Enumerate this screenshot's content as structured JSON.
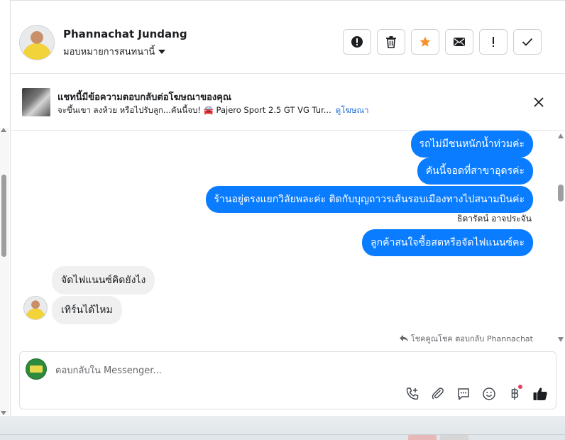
{
  "header": {
    "contact_name": "Phannachat Jundang",
    "assign_label": "มอบหมายการสนทนานี้",
    "actions": [
      {
        "name": "mark-spam-button",
        "icon": "exclamation-circle-icon",
        "glyph": "❗"
      },
      {
        "name": "delete-button",
        "icon": "trash-icon",
        "glyph": "🗑"
      },
      {
        "name": "star-button",
        "icon": "star-icon",
        "glyph": "★"
      },
      {
        "name": "mark-unread-button",
        "icon": "envelope-icon",
        "glyph": "✉"
      },
      {
        "name": "follow-up-button",
        "icon": "exclamation-icon",
        "glyph": "!"
      },
      {
        "name": "mark-done-button",
        "icon": "check-icon",
        "glyph": "✓"
      }
    ]
  },
  "ad": {
    "title": "แชทนี้มีข้อความตอบกลับต่อโฆษณาของคุณ",
    "description": "จะขึ้นเขา ลงห้วย หรือไปรับลูก...คันนี้จบ! 🚘 Pajero Sport 2.5 GT VG Tur...",
    "link_label": "ดูโฆษณา"
  },
  "messages": {
    "outgoing_1": "รถไม่มีชนหนักน้ำท่วมค่ะ",
    "outgoing_2": "คันนี้จอดที่สาขาอุดรค่ะ",
    "outgoing_3": "ร้านอยู่ตรงแยกวิลัยพละค่ะ ติดกับบุญถาวรเส้นรอบเมืองทางไปสนามบินค่ะ",
    "sender_name": "ธิดารัตน์ อาจประจัน",
    "outgoing_4": "ลูกค้าสนใจซื้อสดหรือจัดไฟแนนซ์คะ",
    "incoming_1": "จัดไฟแนนซ์คิดยังไง",
    "incoming_2": "เทิร์นได้ไหม",
    "reply_note": "โชคคูณโชค ตอบกลับ Phannachat"
  },
  "composer": {
    "placeholder": "ตอบกลับใน Messenger..."
  },
  "colors": {
    "outgoing_bubble": "#0a7cff",
    "incoming_bubble": "#f0f0f0",
    "link": "#216fdb",
    "star": "#f5922a",
    "notification_dot": "#e4405f"
  }
}
